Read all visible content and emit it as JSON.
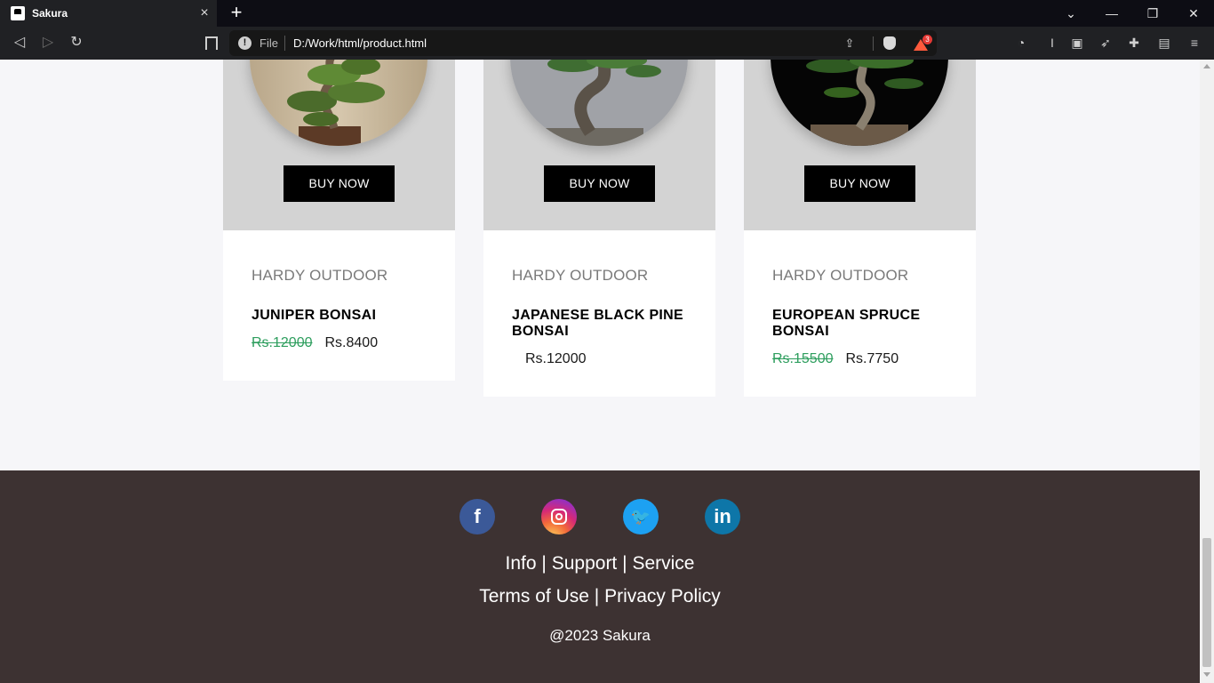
{
  "browser": {
    "tab_title": "Sakura",
    "tab_close": "×",
    "new_tab": "+",
    "address_scheme": "File",
    "address_url": "D:/Work/html/product.html",
    "rewards_badge": "3",
    "window_controls": {
      "chevron": "⌄",
      "minimize": "—",
      "restore": "❐",
      "close": "✕"
    }
  },
  "products": [
    {
      "category": "HARDY OUTDOOR",
      "name": "JUNIPER BONSAI",
      "old_price": "Rs.12000",
      "price": "Rs.8400",
      "buy_label": "BUY NOW",
      "photo_bg": "#c8b79a"
    },
    {
      "category": "HARDY OUTDOOR",
      "name": "JAPANESE BLACK PINE BONSAI",
      "old_price": "",
      "price": "Rs.12000",
      "buy_label": "BUY NOW",
      "photo_bg": "#9c9ea3"
    },
    {
      "category": "HARDY OUTDOOR",
      "name": "EUROPEAN SPRUCE BONSAI",
      "old_price": "Rs.15500",
      "price": "Rs.7750",
      "buy_label": "BUY NOW",
      "photo_bg": "#050505"
    }
  ],
  "footer": {
    "social": [
      {
        "name": "facebook",
        "glyph": "f"
      },
      {
        "name": "instagram",
        "glyph": ""
      },
      {
        "name": "twitter",
        "glyph": "🐦"
      },
      {
        "name": "linkedin",
        "glyph": "in"
      }
    ],
    "links_row1": [
      "Info",
      "Support",
      "Service"
    ],
    "links_row2": [
      "Terms of Use",
      "Privacy Policy"
    ],
    "separator": "|",
    "copyright": "@2023 Sakura"
  },
  "colors": {
    "card_top": "#d3d3d3",
    "strike_price": "#2e9e5e",
    "footer_bg": "#3d3232",
    "page_bg": "#f6f6f9"
  }
}
